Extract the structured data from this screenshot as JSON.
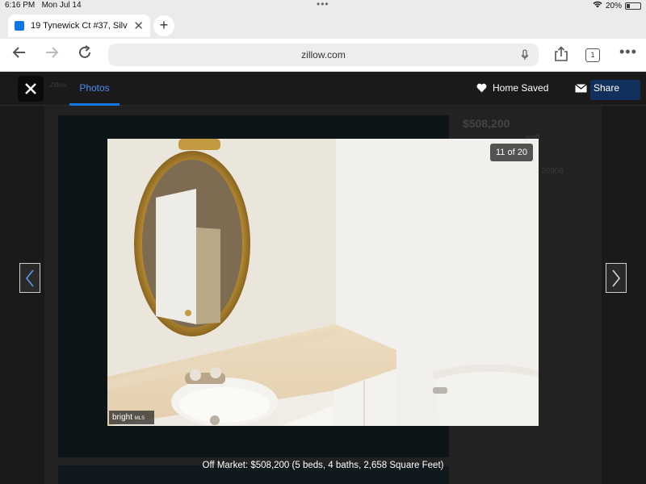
{
  "status": {
    "time": "6:16 PM",
    "date": "Mon Jul 14",
    "battery": "20%"
  },
  "browser": {
    "tab_title": "19 Tynewick Ct #37, Silv",
    "url": "zillow.com",
    "tab_count": "1"
  },
  "viewer": {
    "tab_label": "Photos",
    "saved_label": "Home Saved",
    "share_label": "Share",
    "counter": "11 of 20",
    "caption": "Off Market: $508,200 (5 beds, 4 baths, 2,658 Square Feet)",
    "watermark": "bright",
    "watermark_suffix": "MLS"
  },
  "background": {
    "brand": "Zillow",
    "price": "$508,200",
    "sqft": "sqft",
    "zip": "20906"
  },
  "colors": {
    "accent": "#1277e1",
    "overlay": "#1a1a1a"
  }
}
